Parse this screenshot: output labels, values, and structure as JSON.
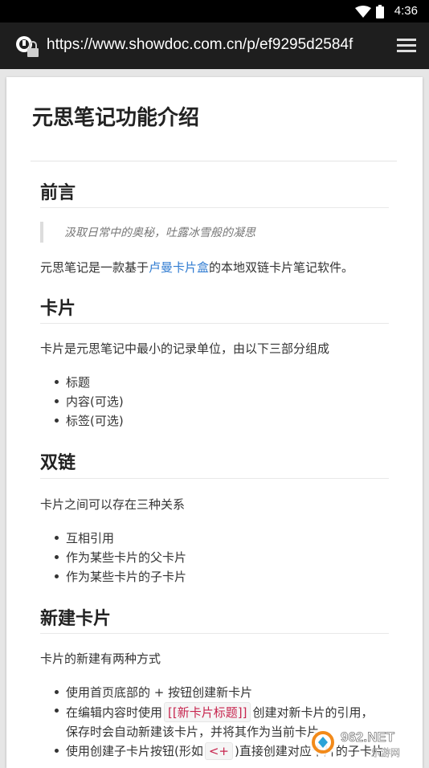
{
  "status": {
    "time": "4:36"
  },
  "browser": {
    "url": "https://www.showdoc.com.cn/p/ef9295d2584f"
  },
  "doc": {
    "title": "元思笔记功能介绍",
    "sections": {
      "preface": {
        "heading": "前言",
        "quote": "汲取日常中的奥秘，吐露冰雪般的凝思",
        "para_pre": "元思笔记是一款基于",
        "para_link": "卢曼卡片盒",
        "para_post": "的本地双链卡片笔记软件。"
      },
      "card": {
        "heading": "卡片",
        "para": "卡片是元思笔记中最小的记录单位，由以下三部分组成",
        "items": [
          "标题",
          "内容(可选)",
          "标签(可选)"
        ]
      },
      "link": {
        "heading": "双链",
        "para": "卡片之间可以存在三种关系",
        "items": [
          "互相引用",
          "作为某些卡片的父卡片",
          "作为某些卡片的子卡片"
        ]
      },
      "new": {
        "heading": "新建卡片",
        "para": "卡片的新建有两种方式",
        "item1": "使用首页底部的 + 按钮创建新卡片",
        "item2_pre": "在编辑内容时使用",
        "item2_code": "[[新卡片标题]]",
        "item2_post": "创建对新卡片的引用，",
        "item2_line2": "保存时会自动新建该卡片，并将其作为当前卡片",
        "item3_pre": "使用创建子卡片按钮(形如",
        "item3_code": "<+",
        "item3_post": ")直接创建对应卡片的子卡片"
      }
    }
  },
  "watermark": {
    "text": "962.NET",
    "subtext": "乐游网"
  }
}
